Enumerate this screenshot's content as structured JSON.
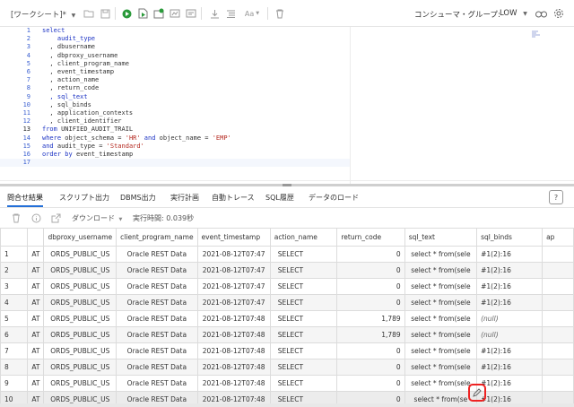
{
  "toolbar": {
    "worksheet_label": "[ワークシート]*",
    "consumer_group_label": "コンシューマ・グループ:",
    "consumer_group_value": "LOW",
    "colors": {
      "run": "#2a9a3a",
      "accent": "#2470d8"
    }
  },
  "editor": {
    "line_numbers": [
      "1",
      "2",
      "3",
      "4",
      "5",
      "6",
      "7",
      "8",
      "9",
      "10",
      "11",
      "12",
      "13",
      "14",
      "15",
      "16",
      "17"
    ],
    "lines": [
      [
        {
          "t": "select",
          "c": "kw"
        }
      ],
      [
        {
          "t": "    audit_type",
          "c": "hl"
        }
      ],
      [
        {
          "t": "  , dbusername",
          "c": ""
        }
      ],
      [
        {
          "t": "  , dbproxy_username",
          "c": ""
        }
      ],
      [
        {
          "t": "  , client_program_name",
          "c": ""
        }
      ],
      [
        {
          "t": "  , event_timestamp",
          "c": ""
        }
      ],
      [
        {
          "t": "  , action_name",
          "c": ""
        }
      ],
      [
        {
          "t": "  , return_code",
          "c": ""
        }
      ],
      [
        {
          "t": "  , sql_text",
          "c": "hl"
        }
      ],
      [
        {
          "t": "  , sql_binds",
          "c": ""
        }
      ],
      [
        {
          "t": "  , application_contexts",
          "c": ""
        }
      ],
      [
        {
          "t": "  , client_identifier",
          "c": ""
        }
      ],
      [
        {
          "t": "from ",
          "c": "kw"
        },
        {
          "t": "UNIFIED_AUDIT_TRAIL",
          "c": ""
        }
      ],
      [
        {
          "t": "where ",
          "c": "kw"
        },
        {
          "t": "object_schema = ",
          "c": ""
        },
        {
          "t": "'HR'",
          "c": "str"
        },
        {
          "t": " and ",
          "c": "kw"
        },
        {
          "t": "object_name = ",
          "c": ""
        },
        {
          "t": "'EMP'",
          "c": "str"
        }
      ],
      [
        {
          "t": "and ",
          "c": "kw"
        },
        {
          "t": "audit_type = ",
          "c": ""
        },
        {
          "t": "'Standard'",
          "c": "str"
        }
      ],
      [
        {
          "t": "order by ",
          "c": "kw"
        },
        {
          "t": "event_timestamp",
          "c": ""
        }
      ],
      [
        {
          "t": "",
          "c": ""
        }
      ]
    ]
  },
  "tabs": [
    {
      "label": "問合せ結果",
      "active": true
    },
    {
      "label": "スクリプト出力",
      "active": false
    },
    {
      "label": "DBMS出力",
      "active": false
    },
    {
      "label": "実行計画",
      "active": false
    },
    {
      "label": "自動トレース",
      "active": false
    },
    {
      "label": "SQL履歴",
      "active": false
    },
    {
      "label": "データのロード",
      "active": false
    }
  ],
  "help_label": "?",
  "results_toolbar": {
    "download_label": "ダウンロード",
    "exec_time": "実行時間: 0.039秒"
  },
  "grid": {
    "columns": [
      "",
      "",
      "dbproxy_username",
      "client_program_name",
      "event_timestamp",
      "action_name",
      "return_code",
      "sql_text",
      "sql_binds",
      "ap"
    ],
    "rows": [
      [
        "1",
        "AT",
        "ORDS_PUBLIC_US",
        "Oracle REST Data",
        "2021-08-12T07:47",
        "SELECT",
        "0",
        "select * from(sele",
        "#1(2):16",
        ""
      ],
      [
        "2",
        "AT",
        "ORDS_PUBLIC_US",
        "Oracle REST Data",
        "2021-08-12T07:47",
        "SELECT",
        "0",
        "select * from(sele",
        "#1(2):16",
        ""
      ],
      [
        "3",
        "AT",
        "ORDS_PUBLIC_US",
        "Oracle REST Data",
        "2021-08-12T07:47",
        "SELECT",
        "0",
        "select * from(sele",
        "#1(2):16",
        ""
      ],
      [
        "4",
        "AT",
        "ORDS_PUBLIC_US",
        "Oracle REST Data",
        "2021-08-12T07:47",
        "SELECT",
        "0",
        "select * from(sele",
        "#1(2):16",
        ""
      ],
      [
        "5",
        "AT",
        "ORDS_PUBLIC_US",
        "Oracle REST Data",
        "2021-08-12T07:48",
        "SELECT",
        "1,789",
        "select * from(sele",
        "(null)",
        ""
      ],
      [
        "6",
        "AT",
        "ORDS_PUBLIC_US",
        "Oracle REST Data",
        "2021-08-12T07:48",
        "SELECT",
        "1,789",
        "select * from(sele",
        "(null)",
        ""
      ],
      [
        "7",
        "AT",
        "ORDS_PUBLIC_US",
        "Oracle REST Data",
        "2021-08-12T07:48",
        "SELECT",
        "0",
        "select * from(sele",
        "#1(2):16",
        ""
      ],
      [
        "8",
        "AT",
        "ORDS_PUBLIC_US",
        "Oracle REST Data",
        "2021-08-12T07:48",
        "SELECT",
        "0",
        "select * from(sele",
        "#1(2):16",
        ""
      ],
      [
        "9",
        "AT",
        "ORDS_PUBLIC_US",
        "Oracle REST Data",
        "2021-08-12T07:48",
        "SELECT",
        "0",
        "select * from(sele",
        "#1(2):16",
        ""
      ],
      [
        "10",
        "AT",
        "ORDS_PUBLIC_US",
        "Oracle REST Data",
        "2021-08-12T07:48",
        "SELECT",
        "0",
        "select * from(se",
        "#1(2):16",
        ""
      ]
    ]
  }
}
